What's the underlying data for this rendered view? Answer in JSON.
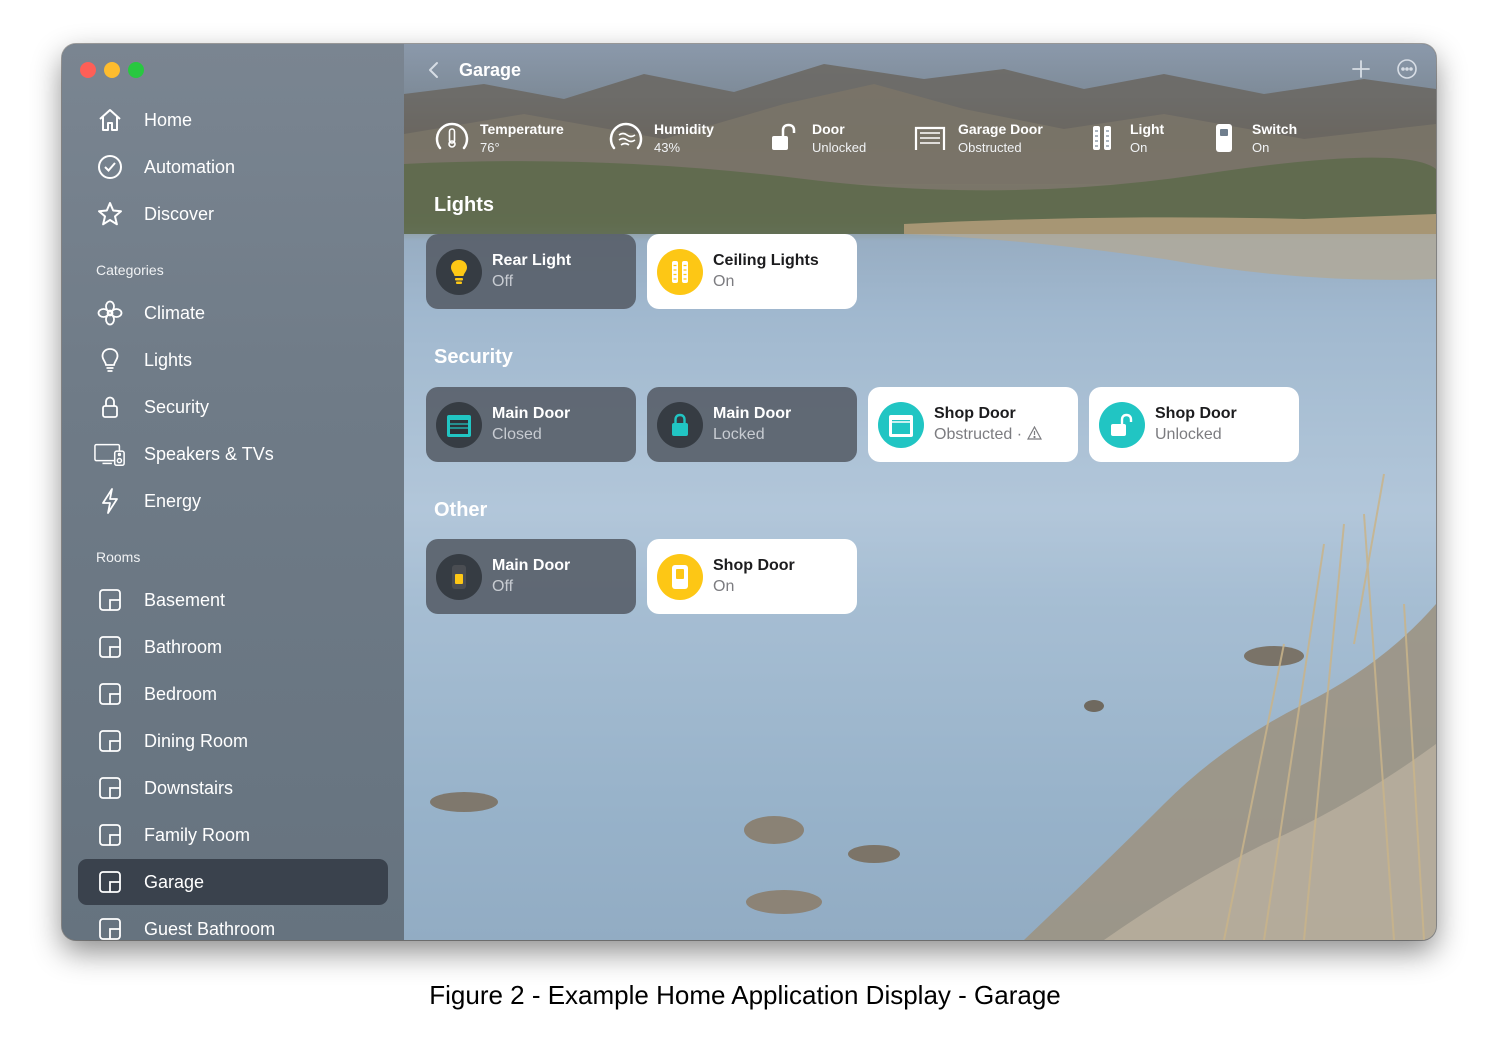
{
  "window": {
    "title": "Garage"
  },
  "sidebar": {
    "top_items": [
      {
        "label": "Home",
        "icon": "house-icon"
      },
      {
        "label": "Automation",
        "icon": "clock-check-icon"
      },
      {
        "label": "Discover",
        "icon": "star-icon"
      }
    ],
    "categories_label": "Categories",
    "categories": [
      {
        "label": "Climate",
        "icon": "fan-icon"
      },
      {
        "label": "Lights",
        "icon": "lightbulb-icon"
      },
      {
        "label": "Security",
        "icon": "lock-icon"
      },
      {
        "label": "Speakers & TVs",
        "icon": "tv-speaker-icon"
      },
      {
        "label": "Energy",
        "icon": "bolt-icon"
      }
    ],
    "rooms_label": "Rooms",
    "rooms": [
      {
        "label": "Basement"
      },
      {
        "label": "Bathroom"
      },
      {
        "label": "Bedroom"
      },
      {
        "label": "Dining Room"
      },
      {
        "label": "Downstairs"
      },
      {
        "label": "Family Room"
      },
      {
        "label": "Garage",
        "selected": true
      },
      {
        "label": "Guest Bathroom"
      }
    ]
  },
  "status_bar": [
    {
      "name": "Temperature",
      "value": "76°",
      "icon": "thermometer-icon"
    },
    {
      "name": "Humidity",
      "value": "43%",
      "icon": "humidity-icon"
    },
    {
      "name": "Door",
      "value": "Unlocked",
      "icon": "unlocked-icon"
    },
    {
      "name": "Garage Door",
      "value": "Obstructed",
      "icon": "garage-door-icon"
    },
    {
      "name": "Light",
      "value": "On",
      "icon": "light-panel-icon"
    },
    {
      "name": "Switch",
      "value": "On",
      "icon": "switch-icon"
    }
  ],
  "sections": {
    "lights": {
      "title": "Lights",
      "tiles": [
        {
          "name": "Rear Light",
          "status": "Off",
          "state": "off",
          "icon": "lightbulb-icon"
        },
        {
          "name": "Ceiling Lights",
          "status": "On",
          "state": "on",
          "icon": "light-panel-icon"
        }
      ]
    },
    "security": {
      "title": "Security",
      "tiles": [
        {
          "name": "Main Door",
          "status": "Closed",
          "state": "off",
          "icon": "garage-door-icon"
        },
        {
          "name": "Main Door",
          "status": "Locked",
          "state": "off",
          "icon": "lock-icon"
        },
        {
          "name": "Shop Door",
          "status": "Obstructed ·",
          "state": "on",
          "icon": "garage-door-icon"
        },
        {
          "name": "Shop Door",
          "status": "Unlocked",
          "state": "on",
          "icon": "unlocked-icon"
        }
      ]
    },
    "other": {
      "title": "Other",
      "tiles": [
        {
          "name": "Main Door",
          "status": "Off",
          "state": "off",
          "icon": "switch-icon"
        },
        {
          "name": "Shop Door",
          "status": "On",
          "state": "on",
          "icon": "switch-icon"
        }
      ]
    }
  },
  "colors": {
    "light_on": "#fdc715",
    "security_teal": "#21c5c3",
    "sidebar_bg": "#707c88",
    "selected_bg": "#323a44"
  },
  "caption": "Figure 2 - Example Home Application Display - Garage"
}
